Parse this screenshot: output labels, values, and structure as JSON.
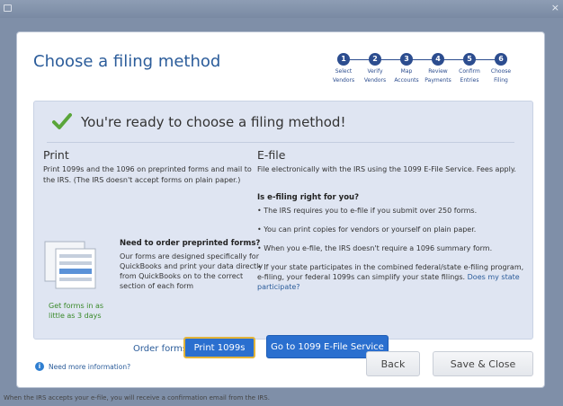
{
  "window": {
    "close_label": "×"
  },
  "dialog": {
    "title": "Choose a filing method",
    "steps": [
      {
        "num": "1",
        "label_line1": "Select",
        "label_line2": "Vendors"
      },
      {
        "num": "2",
        "label_line1": "Verify",
        "label_line2": "Vendors"
      },
      {
        "num": "3",
        "label_line1": "Map",
        "label_line2": "Accounts"
      },
      {
        "num": "4",
        "label_line1": "Review",
        "label_line2": "Payments"
      },
      {
        "num": "5",
        "label_line1": "Confirm",
        "label_line2": "Entries"
      },
      {
        "num": "6",
        "label_line1": "Choose",
        "label_line2": "Filing"
      }
    ],
    "ready_text": "You're ready to choose a filing method!"
  },
  "print": {
    "heading": "Print",
    "text": "Print 1099s and the 1096 on preprinted forms and mail to the IRS. (The IRS doesn't accept forms on plain paper.)",
    "preprinted_heading": "Need to order preprinted forms?",
    "preprinted_text": "Our forms are designed specifically for QuickBooks and print your data directly from QuickBooks on to the correct section of each form",
    "get_forms_text": "Get forms in as little as 3 days",
    "order_forms_label": "Order forms",
    "print_button_label": "Print 1099s"
  },
  "efile": {
    "heading": "E-file",
    "text": "File electronically with the IRS using the 1099 E-File Service. Fees apply.",
    "subheading": "Is e-filing right for you?",
    "bullets": [
      "• The IRS requires you to e-file if you submit over 250 forms.",
      "• You can print copies for vendors or yourself on plain paper.",
      "• When you e-file, the IRS doesn't require a 1096 summary form.",
      "• If your state participates in the combined federal/state e-filing program, e-filing, your federal 1099s can simplify your state filings."
    ],
    "state_link": "Does my state participate?",
    "button_label": "Go to 1099 E-File Service"
  },
  "footer": {
    "info_label": "Need more information?",
    "back_label": "Back",
    "save_close_label": "Save & Close"
  },
  "bottom_text": "When the IRS accepts your e-file, you will receive a confirmation email from the IRS."
}
